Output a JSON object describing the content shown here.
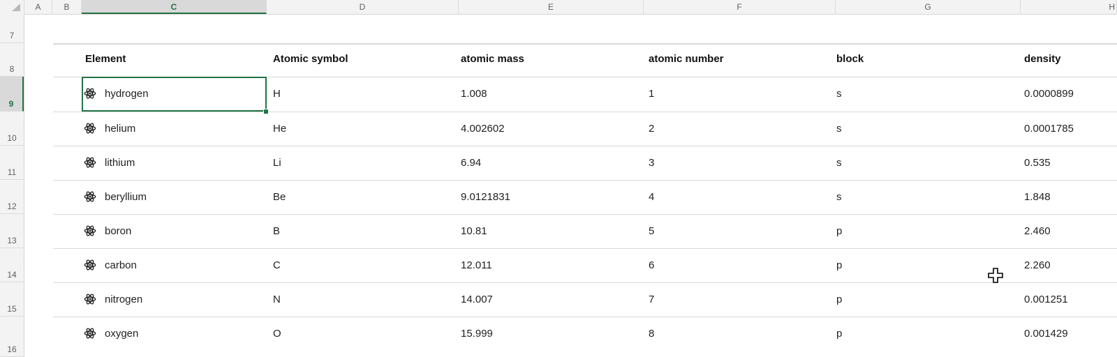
{
  "columns": [
    "A",
    "B",
    "C",
    "D",
    "E",
    "F",
    "G",
    "H"
  ],
  "rows": [
    "7",
    "8",
    "9",
    "10",
    "11",
    "12",
    "13",
    "14",
    "15",
    "16"
  ],
  "table": {
    "headers": [
      "Element",
      "Atomic symbol",
      "atomic mass",
      "atomic number",
      "block",
      "density"
    ],
    "data": [
      [
        "hydrogen",
        "H",
        "1.008",
        "1",
        "s",
        "0.0000899"
      ],
      [
        "helium",
        "He",
        "4.002602",
        "2",
        "s",
        "0.0001785"
      ],
      [
        "lithium",
        "Li",
        "6.94",
        "3",
        "s",
        "0.535"
      ],
      [
        "beryllium",
        "Be",
        "9.0121831",
        "4",
        "s",
        "1.848"
      ],
      [
        "boron",
        "B",
        "10.81",
        "5",
        "p",
        "2.460"
      ],
      [
        "carbon",
        "C",
        "12.011",
        "6",
        "p",
        "2.260"
      ],
      [
        "nitrogen",
        "N",
        "14.007",
        "7",
        "p",
        "0.001251"
      ],
      [
        "oxygen",
        "O",
        "15.999",
        "8",
        "p",
        "0.001429"
      ]
    ]
  },
  "icons": {
    "element": "atom-icon",
    "cursor": "cell-select-cursor-icon"
  },
  "colors": {
    "accent": "#217346",
    "grid": "#d8d8d8",
    "header_bg": "#f3f3f3"
  }
}
